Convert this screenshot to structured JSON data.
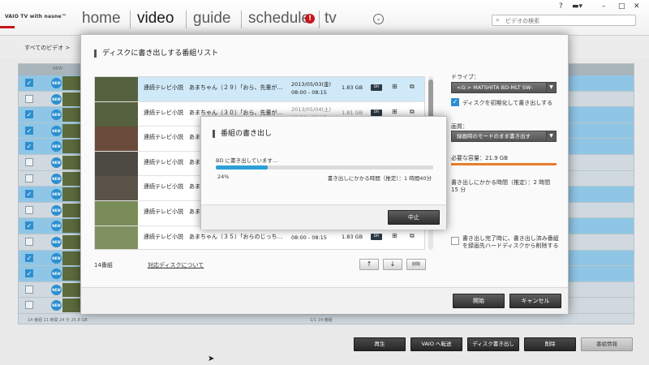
{
  "app": {
    "brand": "VAIO TV with nasne™",
    "nav": [
      "home",
      "video",
      "guide",
      "schedule",
      "tv"
    ],
    "alert_badge": "!",
    "search_placeholder": "ビデオの検索",
    "help_label": "?"
  },
  "background": {
    "breadcrumb": "すべてのビデオ  >",
    "column_new": "NEW",
    "footer_text": "14 番組   11 時間 24 分  25.8 GB",
    "footer_page": "1/1   14 番組",
    "new_badge": "NEW",
    "check_mark": "✓"
  },
  "modal": {
    "title": "ディスクに書き出しする番組リスト",
    "rows": [
      {
        "title": "連続テレビ小説　あまちゃん（２９）「おら、先輩が…",
        "date": "2013/05/03(金)",
        "time": "08:00 - 08:15",
        "size": "1.83 GB",
        "quality": "DR"
      },
      {
        "title": "連続テレビ小説　あまちゃん（３０）「おら、先輩が…",
        "date": "2013/05/04(土)",
        "time": "08:00 - 08:15",
        "size": "1.81 GB",
        "quality": "DR"
      },
      {
        "title": "連続テレビ小説　あまちゃん",
        "date": "",
        "time": "",
        "size": "",
        "quality": ""
      },
      {
        "title": "連続テレビ小説　あまちゃん",
        "date": "",
        "time": "",
        "size": "",
        "quality": ""
      },
      {
        "title": "連続テレビ小説　あまちゃん",
        "date": "",
        "time": "",
        "size": "",
        "quality": ""
      },
      {
        "title": "連続テレビ小説　あまちゃん",
        "date": "",
        "time": "",
        "size": "",
        "quality": ""
      },
      {
        "title": "連続テレビ小説　あまちゃん（３５）「おらのじっち…",
        "date": "",
        "time": "08:00 - 08:15",
        "size": "1.83 GB",
        "quality": "DR"
      }
    ],
    "count": "14番組",
    "disc_link": "対応ディスクについて",
    "up_label": "↑",
    "down_label": "↓",
    "delete_label": "削除",
    "drive_label": "ドライブ：",
    "drive_value": "<G:> MATSHITA BD-MLT SW-",
    "format_checkbox_label": "ディスクを初期化して書き出しする",
    "quality_label": "画質：",
    "quality_value": "録画時のモードのまま書き出す",
    "required_capacity": "必要な容量：21.9 GB",
    "write_time": "書き出しにかかる時間（推定）：2 時間 15 分",
    "delete_after_label": "書き出し完了時に、書き出し済み番組を録画先ハードディスクから削除する",
    "start_button": "開始",
    "cancel_button": "キャンセル"
  },
  "progress": {
    "title": "番組の書き出し",
    "message": "BD に書き出しています…",
    "percent_label": "24%",
    "percent_value": 0.24,
    "time_estimate": "書き出しにかかる時間（推定）：1 時間40分",
    "stop_button": "中止"
  },
  "toolbar": {
    "play": "再生",
    "vaio_transfer": "VAIO へ転送",
    "disc_write": "ディスク書き出し",
    "delete": "削除",
    "program_info": "番組情報"
  },
  "colors": {
    "accent": "#2d9fd8",
    "alert": "#c8161d",
    "capacity_bar": "#e87d2c",
    "selected_row": "#cfe9f8"
  }
}
